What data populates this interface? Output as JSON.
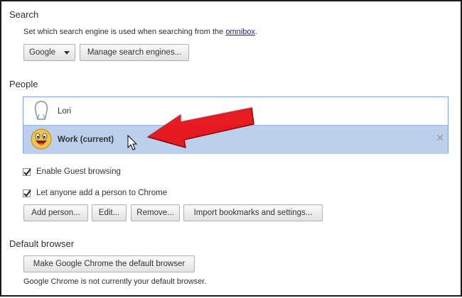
{
  "search": {
    "title": "Search",
    "description_prefix": "Set which search engine is used when searching from the ",
    "description_link": "omnibox",
    "description_suffix": ".",
    "engine_selected": "Google",
    "manage_button": "Manage search engines..."
  },
  "people": {
    "title": "People",
    "profiles": [
      {
        "name": "Lori",
        "avatar_icon": "silhouette-avatar-icon",
        "selected": false
      },
      {
        "name": "Work (current)",
        "avatar_icon": "smiley-avatar-icon",
        "selected": true
      }
    ],
    "remove_glyph": "✕",
    "guest_checkbox": {
      "label": "Enable Guest browsing",
      "checked": true
    },
    "anyone_checkbox": {
      "label": "Let anyone add a person to Chrome",
      "checked": true
    },
    "buttons": {
      "add": "Add person...",
      "edit": "Edit...",
      "remove": "Remove...",
      "import": "Import bookmarks and settings..."
    }
  },
  "default_browser": {
    "title": "Default browser",
    "make_default_button": "Make Google Chrome the default browser",
    "status": "Google Chrome is not currently your default browser."
  },
  "colors": {
    "selection_bg": "#bcd0ec",
    "list_border": "#7ba4e8",
    "annotation_arrow": "#e8141b",
    "link": "#1a1aa6"
  }
}
